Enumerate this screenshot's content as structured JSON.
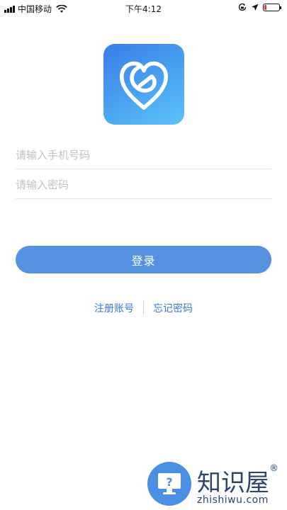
{
  "status_bar": {
    "carrier": "中国移动",
    "time": "下午4:12",
    "battery_level": 0.15
  },
  "login": {
    "phone_placeholder": "请输入手机号码",
    "password_placeholder": "请输入密码",
    "login_button": "登录",
    "register_link": "注册账号",
    "forgot_link": "忘记密码"
  },
  "watermark": {
    "title": "知识屋",
    "registered": "®",
    "subtitle": "zhishiwu.com"
  },
  "colors": {
    "accent": "#5592e1",
    "link": "#3a78d4",
    "logo_gradient_start": "#3a7de8",
    "logo_gradient_end": "#5bc3f7"
  },
  "icons": [
    "signal-icon",
    "wifi-icon",
    "rotation-lock-icon",
    "location-icon",
    "battery-icon",
    "app-logo-heart-icon",
    "monitor-question-icon"
  ]
}
